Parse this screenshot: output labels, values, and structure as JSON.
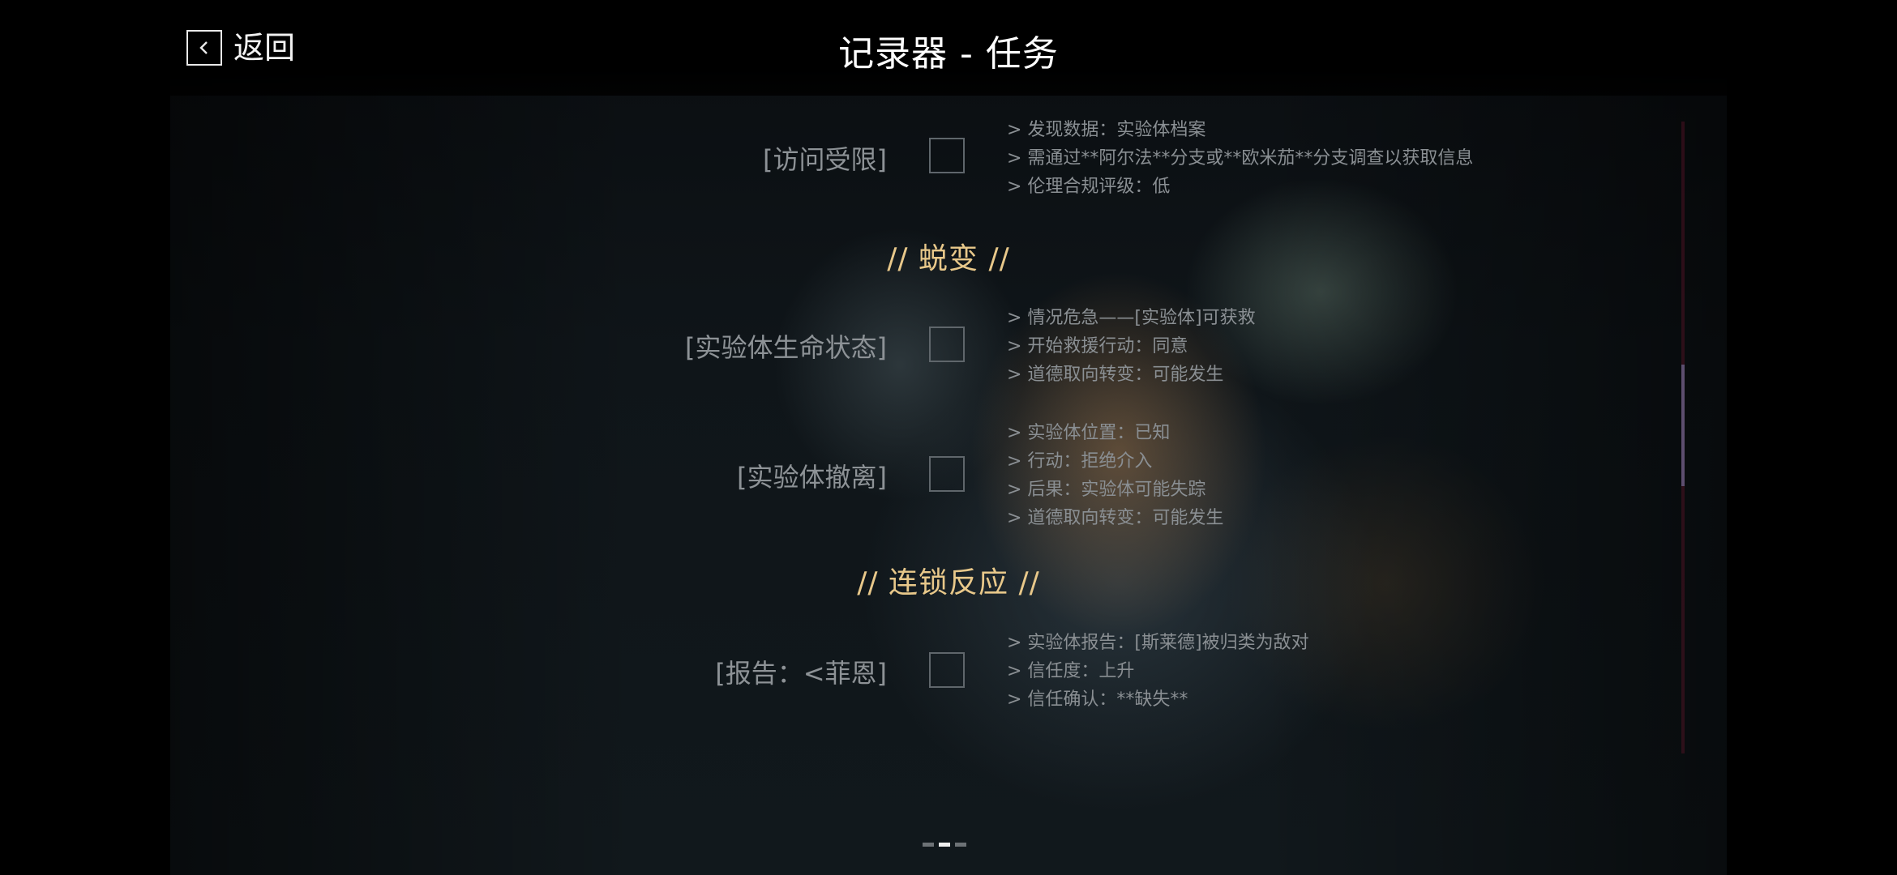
{
  "header": {
    "back_label": "返回",
    "title": "记录器 - 任务"
  },
  "content": {
    "row0": {
      "label": "[访问受限]",
      "checked": false,
      "notes": [
        "> 发现数据：实验体档案",
        "> 需通过**阿尔法**分支或**欧米茄**分支调查以获取信息",
        "> 伦理合规评级：低"
      ]
    },
    "section1": {
      "heading": "// 蜕变 //"
    },
    "row1": {
      "label": "[实验体生命状态]",
      "checked": false,
      "notes": [
        "> 情况危急——[实验体]可获救",
        "> 开始救援行动：同意",
        "> 道德取向转变：可能发生"
      ]
    },
    "row2": {
      "label": "[实验体撤离]",
      "checked": false,
      "notes": [
        "> 实验体位置：已知",
        "> 行动：拒绝介入",
        "> 后果：实验体可能失踪",
        "> 道德取向转变：可能发生"
      ]
    },
    "section2": {
      "heading": "// 连锁反应 //"
    },
    "row3": {
      "label": "[报告：<菲恩]",
      "checked": false,
      "notes": [
        "> 实验体报告：[斯莱德]被归类为敌对",
        "> 信任度：上升",
        "> 信任确认：**缺失**"
      ]
    }
  },
  "pager": {
    "pages": 3,
    "current_page": 2
  },
  "icons": {
    "back": "chevron-left-icon"
  },
  "colors": {
    "heading_gold": "#e8c88a",
    "label_gray": "#8d9296",
    "note_gray": "#8a8f93"
  }
}
